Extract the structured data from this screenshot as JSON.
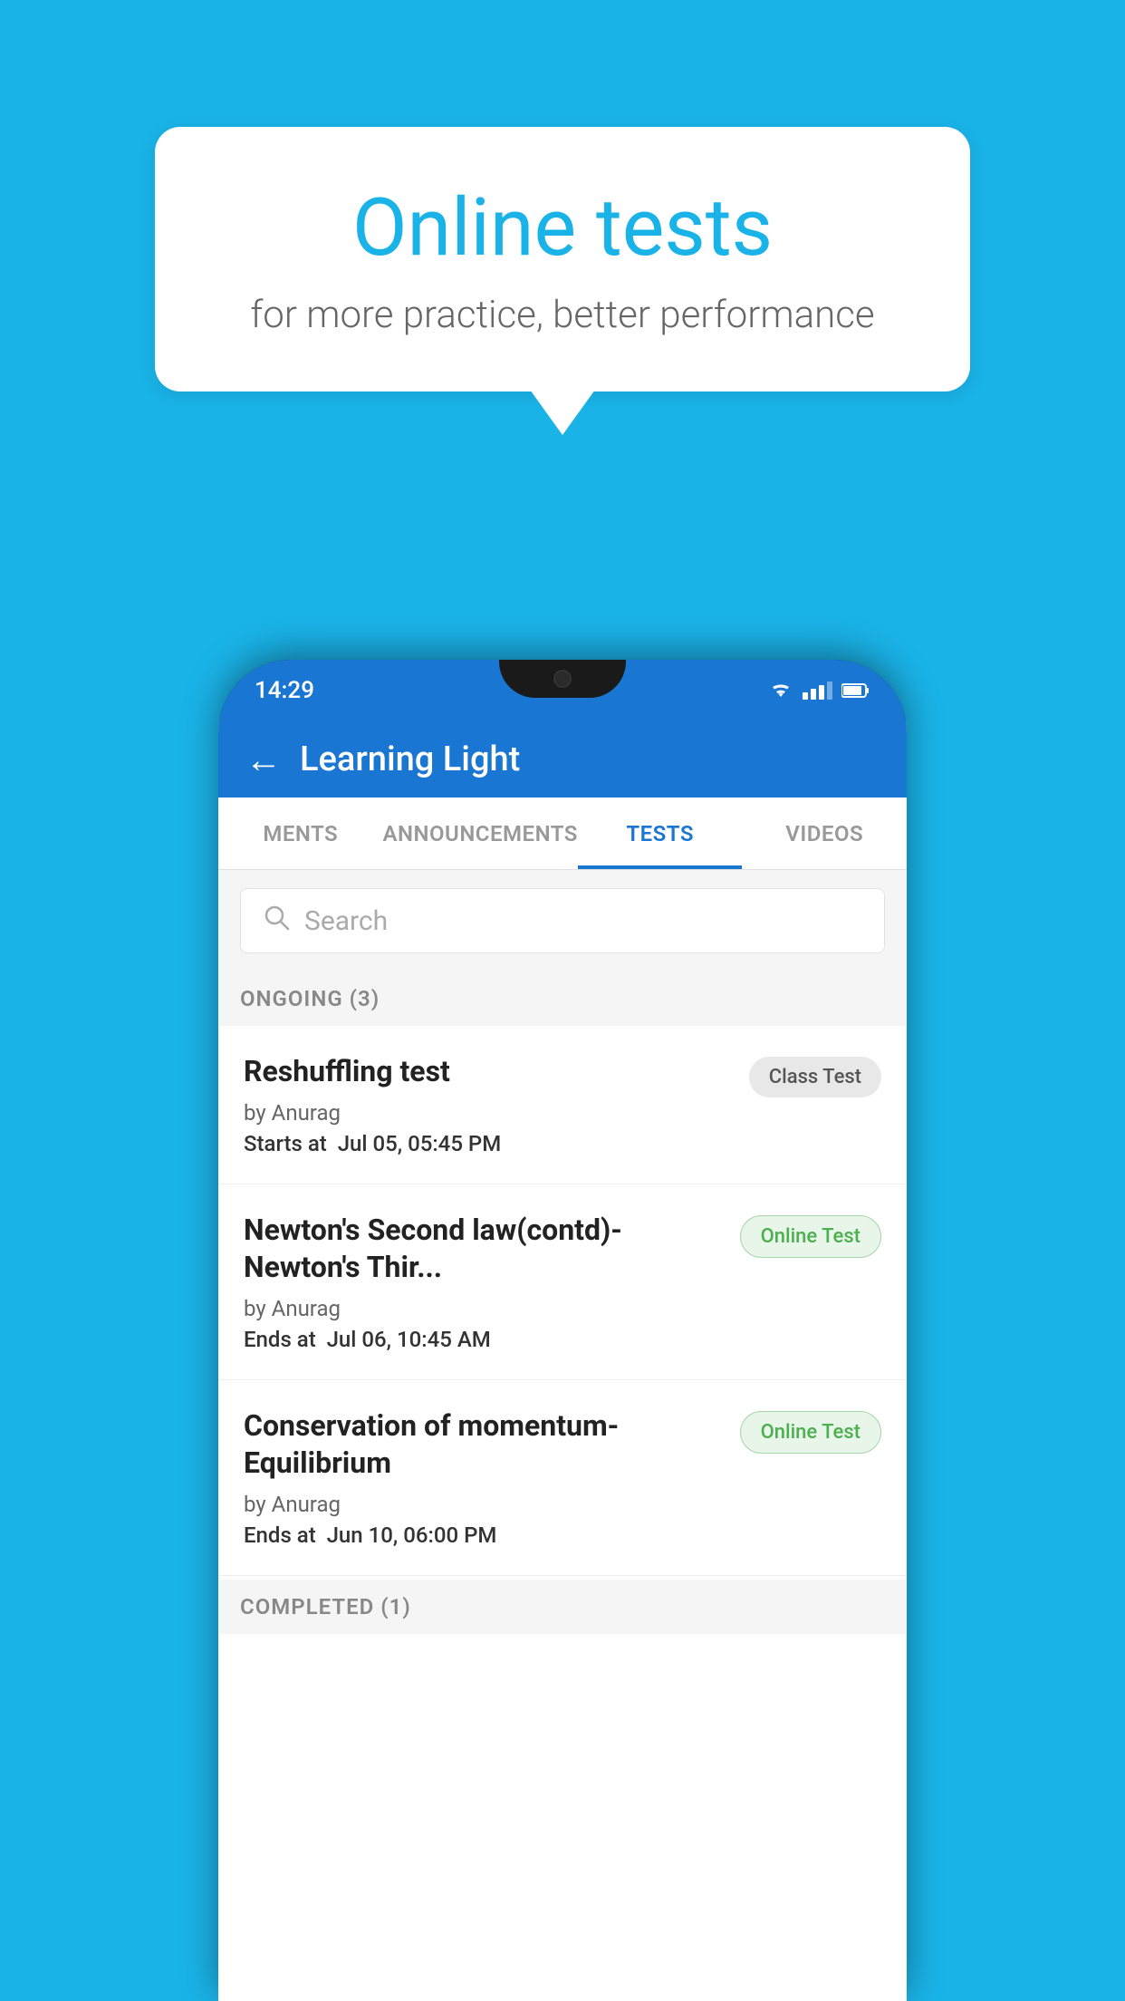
{
  "background_color": "#1ab3e8",
  "speech_bubble": {
    "title": "Online tests",
    "subtitle": "for more practice, better performance"
  },
  "phone": {
    "status_bar": {
      "time": "14:29",
      "wifi": "▼",
      "signal": "▲",
      "battery": "▐"
    },
    "app_header": {
      "back_label": "←",
      "title": "Learning Light"
    },
    "tabs": [
      {
        "label": "MENTS",
        "active": false
      },
      {
        "label": "ANNOUNCEMENTS",
        "active": false
      },
      {
        "label": "TESTS",
        "active": true
      },
      {
        "label": "VIDEOS",
        "active": false
      }
    ],
    "search": {
      "placeholder": "Search",
      "icon": "🔍"
    },
    "ongoing_section": {
      "title": "ONGOING (3)",
      "items": [
        {
          "name": "Reshuffling test",
          "author": "by Anurag",
          "time_label": "Starts at",
          "time_value": "Jul 05, 05:45 PM",
          "badge": "Class Test",
          "badge_type": "class"
        },
        {
          "name": "Newton's Second law(contd)-Newton's Thir...",
          "author": "by Anurag",
          "time_label": "Ends at",
          "time_value": "Jul 06, 10:45 AM",
          "badge": "Online Test",
          "badge_type": "online"
        },
        {
          "name": "Conservation of momentum-Equilibrium",
          "author": "by Anurag",
          "time_label": "Ends at",
          "time_value": "Jun 10, 06:00 PM",
          "badge": "Online Test",
          "badge_type": "online"
        }
      ]
    },
    "completed_section": {
      "title": "COMPLETED (1)"
    }
  }
}
